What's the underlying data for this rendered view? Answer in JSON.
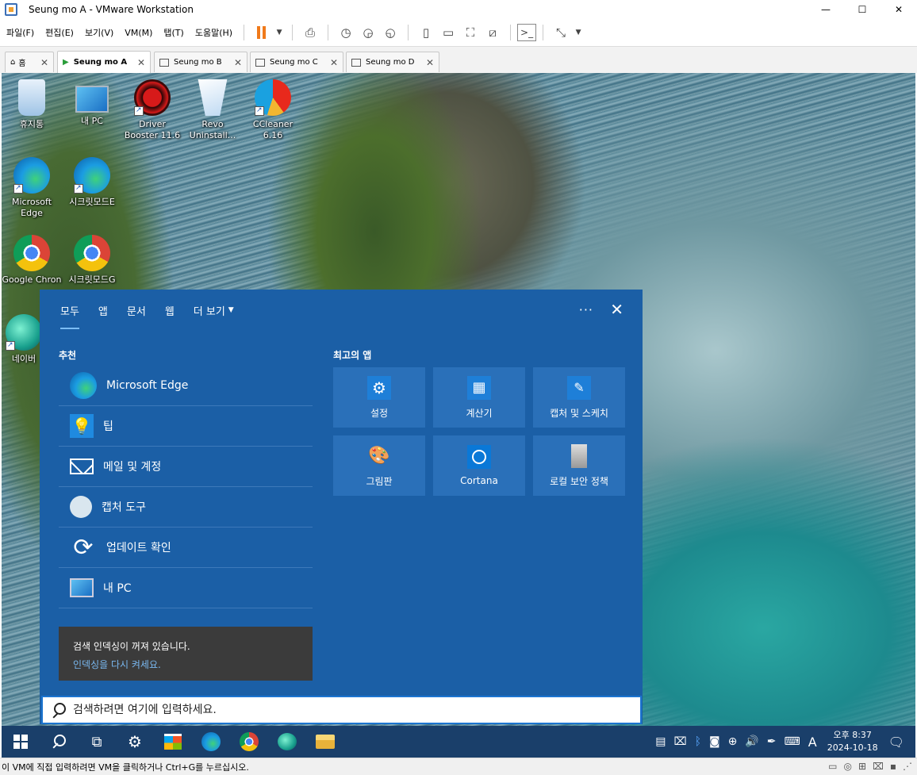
{
  "window": {
    "title": "Seung mo A - VMware Workstation",
    "minimize": "—",
    "maximize": "☐",
    "close": "✕"
  },
  "menu": [
    "파일(F)",
    "편집(E)",
    "보기(V)",
    "VM(M)",
    "탭(T)",
    "도움말(H)"
  ],
  "tabs": [
    {
      "label": "홈",
      "active": false
    },
    {
      "label": "Seung mo A",
      "active": true
    },
    {
      "label": "Seung mo B",
      "active": false
    },
    {
      "label": "Seung mo C",
      "active": false
    },
    {
      "label": "Seung mo D",
      "active": false
    }
  ],
  "desktop": {
    "icons": [
      {
        "label": "휴지통"
      },
      {
        "label": "내 PC"
      },
      {
        "label": "Driver Booster 11.6"
      },
      {
        "label": "Revo Uninstall..."
      },
      {
        "label": "CCleaner 6.16"
      },
      {
        "label": "Microsoft Edge"
      },
      {
        "label": "시크릿모드E"
      },
      {
        "label": "Google Chron"
      },
      {
        "label": "시크릿모드G"
      },
      {
        "label": "네이버"
      }
    ]
  },
  "search": {
    "tabs": [
      "모두",
      "앱",
      "문서",
      "웹",
      "더 보기"
    ],
    "more_arrow": "▼",
    "dots": "···",
    "close": "✕",
    "recommended_title": "추천",
    "recommended": [
      "Microsoft Edge",
      "팁",
      "메일 및 계정",
      "캡처 도구",
      "업데이트 확인",
      "내 PC"
    ],
    "top_apps_title": "최고의 앱",
    "top_apps": [
      "설정",
      "계산기",
      "캡처 및 스케치",
      "그림판",
      "Cortana",
      "로컬 보안 정책"
    ],
    "toast_title": "검색 인덱싱이 꺼져 있습니다.",
    "toast_link": "인덱싱을 다시 켜세요.",
    "placeholder": "검색하려면 여기에 입력하세요."
  },
  "taskbar": {
    "ime": "A",
    "time": "오후 8:37",
    "date": "2024-10-18"
  },
  "status_bar": {
    "text": "이 VM에 직접 입력하려면 VM을 클릭하거나 Ctrl+G를 누르십시오."
  },
  "colors": {
    "search_panel_bg": "#1b5fa6",
    "tile_bg": "#2a70b9",
    "taskbar_bg": "#1a3f6a",
    "pause_accent": "#f07a1a"
  }
}
